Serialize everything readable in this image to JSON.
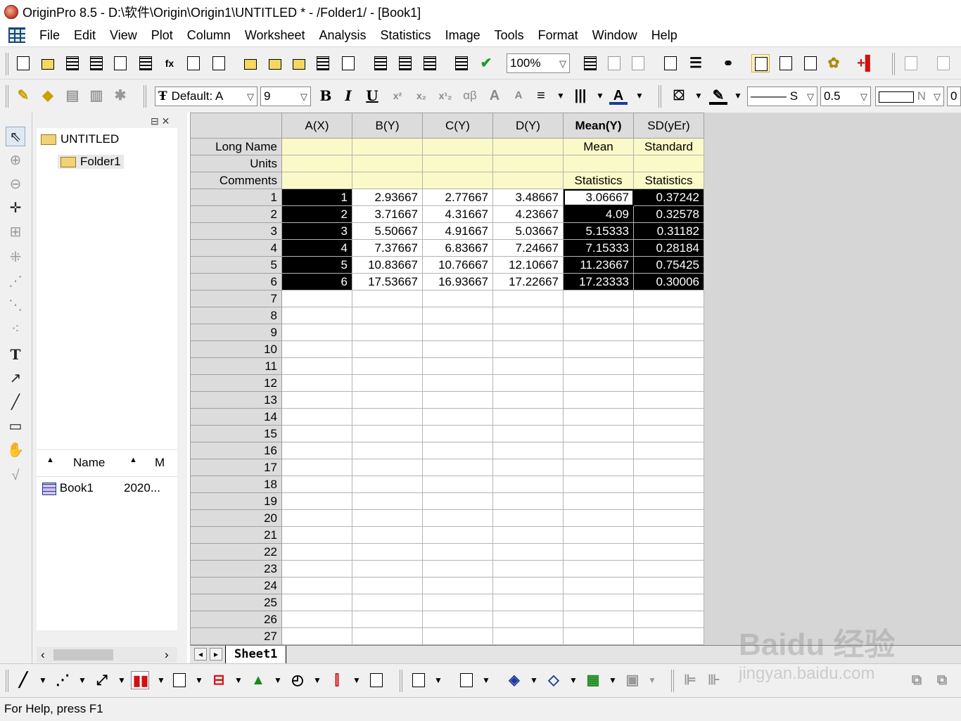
{
  "window": {
    "title": "OriginPro 8.5 - D:\\软件\\Origin\\Origin1\\UNTITLED * - /Folder1/ - [Book1]"
  },
  "menu": [
    "File",
    "Edit",
    "View",
    "Plot",
    "Column",
    "Worksheet",
    "Analysis",
    "Statistics",
    "Image",
    "Tools",
    "Format",
    "Window",
    "Help"
  ],
  "toolbar": {
    "zoom": "100%",
    "font": "Default: A",
    "font_size": "9",
    "line_style": "S",
    "line_width": "0.5",
    "fill": "N",
    "extra": "0",
    "bold": "B",
    "italic": "I",
    "underline": "U",
    "greek": "αβ"
  },
  "project": {
    "root": "UNTITLED",
    "folder": "Folder1",
    "list_headers": [
      "Name",
      "M"
    ],
    "items": [
      {
        "name": "Book1",
        "modified": "2020..."
      }
    ]
  },
  "worksheet": {
    "columns": [
      "A(X)",
      "B(Y)",
      "C(Y)",
      "D(Y)",
      "Mean(Y)",
      "SD(yEr)"
    ],
    "meta_labels": [
      "Long Name",
      "Units",
      "Comments"
    ],
    "long_names": [
      "",
      "",
      "",
      "",
      "Mean",
      "Standard"
    ],
    "units": [
      "",
      "",
      "",
      "",
      "",
      ""
    ],
    "comments": [
      "",
      "",
      "",
      "",
      "Statistics",
      "Statistics"
    ],
    "rows": [
      [
        "1",
        "2.93667",
        "2.77667",
        "3.48667",
        "3.06667",
        "0.37242"
      ],
      [
        "2",
        "3.71667",
        "4.31667",
        "4.23667",
        "4.09",
        "0.32578"
      ],
      [
        "3",
        "5.50667",
        "4.91667",
        "5.03667",
        "5.15333",
        "0.31182"
      ],
      [
        "4",
        "7.37667",
        "6.83667",
        "7.24667",
        "7.15333",
        "0.28184"
      ],
      [
        "5",
        "10.83667",
        "10.76667",
        "12.10667",
        "11.23667",
        "0.75425"
      ],
      [
        "6",
        "17.53667",
        "16.93667",
        "17.22667",
        "17.23333",
        "0.30006"
      ]
    ],
    "row_numbers": [
      "1",
      "2",
      "3",
      "4",
      "5",
      "6",
      "7",
      "8",
      "9",
      "10",
      "11",
      "12",
      "13",
      "14",
      "15",
      "16",
      "17",
      "18",
      "19",
      "20",
      "21",
      "22",
      "23",
      "24",
      "25",
      "26",
      "27"
    ],
    "sheet_tab": "Sheet1"
  },
  "status": "For Help, press F1",
  "watermark": {
    "brand": "Baidu 经验",
    "url": "jingyan.baidu.com"
  }
}
